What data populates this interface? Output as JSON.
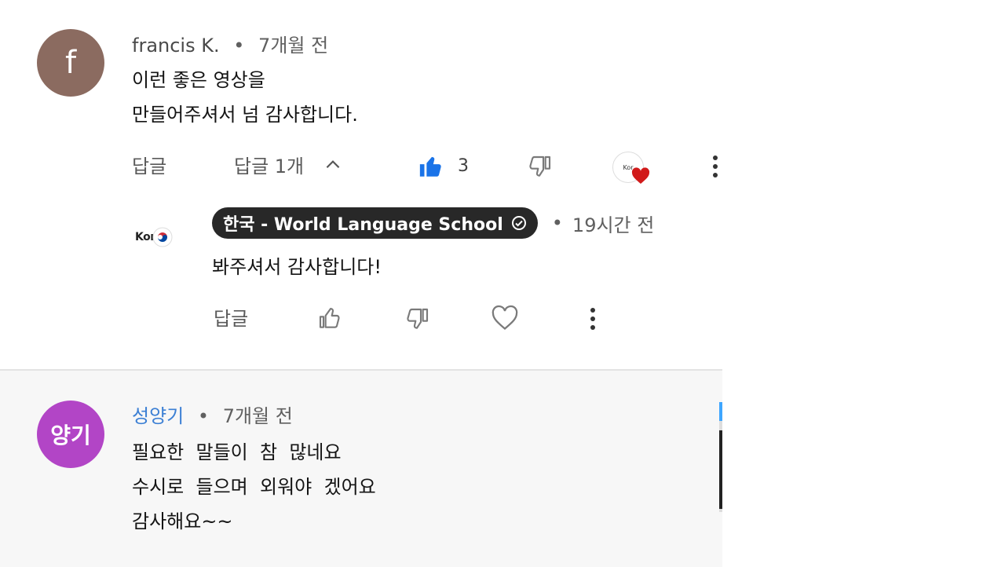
{
  "comment1": {
    "avatar_letter": "f",
    "avatar_color": "#8b6b60",
    "author": "francis K.",
    "separator": "•",
    "time": "7개월 전",
    "lines": [
      "이런 좋은 영상을",
      "만들어주셔서 넘 감사합니다."
    ],
    "reply_label": "답글",
    "replies_toggle": "답글 1개",
    "like_count": "3",
    "like_color": "#1a73e8",
    "heart_color": "#d11a1a"
  },
  "reply1": {
    "avatar_text": "Kor",
    "channel_name": "한국 - World Language School",
    "separator": "•",
    "time": "19시간 전",
    "text": "봐주셔서 감사합니다!",
    "reply_label": "답글"
  },
  "comment2": {
    "avatar_text": "양기",
    "avatar_color": "#b245c6",
    "author": "성양기",
    "separator": "•",
    "time": "7개월 전",
    "lines": [
      "필요한  말들이  참  많네요",
      "수시로  들으며  외워야  겠어요",
      "감사해요~~"
    ]
  }
}
